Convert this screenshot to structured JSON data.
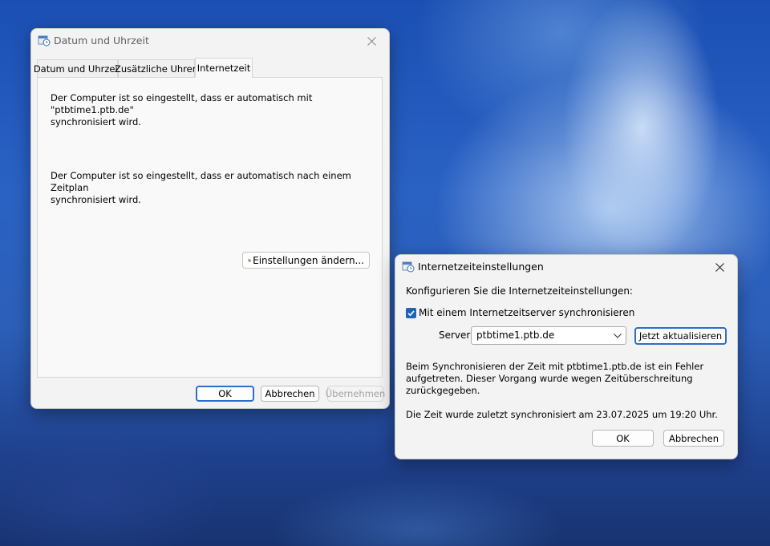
{
  "main_window": {
    "title": "Datum und Uhrzeit",
    "tabs": [
      {
        "label": "Datum und Uhrzeit"
      },
      {
        "label": "Zusätzliche Uhren"
      },
      {
        "label": "Internetzeit"
      }
    ],
    "active_tab": "Internetzeit",
    "sync_server_text": "Der Computer ist so eingestellt, dass er automatisch mit \"ptbtime1.ptb.de\"\nsynchronisiert wird.",
    "sync_schedule_text": "Der Computer ist so eingestellt, dass er automatisch nach einem Zeitplan\nsynchronisiert wird.",
    "change_settings_label": "Einstellungen ändern...",
    "ok_label": "OK",
    "cancel_label": "Abbrechen",
    "apply_label": "Übernehmen"
  },
  "dialog": {
    "title": "Internetzeiteinstellungen",
    "heading": "Konfigurieren Sie die Internetzeiteinstellungen:",
    "sync_checkbox_label": "Mit einem Internetzeitserver synchronisieren",
    "sync_checked": true,
    "server_label": "Server:",
    "server_value": "ptbtime1.ptb.de",
    "update_now_label": "Jetzt aktualisieren",
    "error_text": "Beim Synchronisieren der Zeit mit ptbtime1.ptb.de ist ein Fehler\naufgetreten. Dieser Vorgang wurde wegen Zeitüberschreitung\nzurückgegeben.",
    "last_sync_text": "Die Zeit wurde zuletzt synchronisiert am 23.07.2025 um 19:20 Uhr.",
    "ok_label": "OK",
    "cancel_label": "Abbrechen"
  },
  "icons": {
    "app_icon": "clock-calendar-icon",
    "close_icon": "close-icon",
    "uac_icon": "uac-shield-icon",
    "checkbox_icon": "checkmark-icon",
    "dropdown_icon": "chevron-down-icon"
  },
  "colors": {
    "accent": "#2a6ec9",
    "checkbox_fill": "#1f63b6",
    "window_bg": "#f3f3f3",
    "disabled_text": "#a3a3a3"
  }
}
